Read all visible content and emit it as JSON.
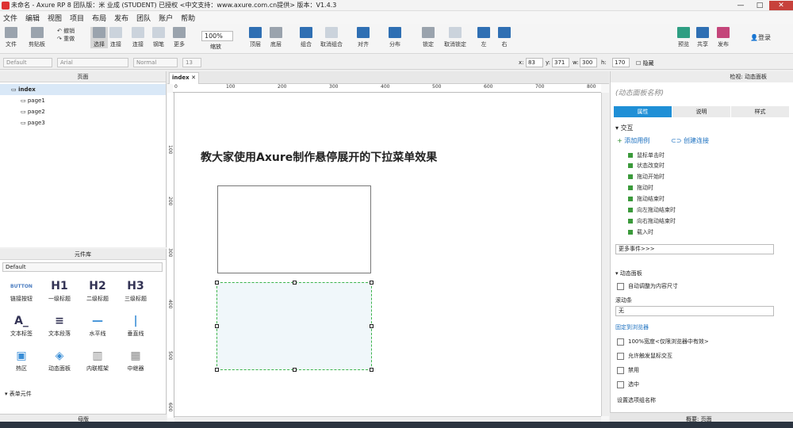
{
  "window": {
    "title": "未命名 - Axure RP 8 团队版：米 业成 (STUDENT) 已授权    <中文支持：www.axure.com.cn提供> 版本：V1.4.3",
    "minimize": "—",
    "maximize": "□",
    "close": "✕"
  },
  "menu": [
    "文件",
    "编辑",
    "视图",
    "项目",
    "布局",
    "发布",
    "团队",
    "账户",
    "帮助"
  ],
  "toolbar": {
    "file": "文件",
    "clipboard": "剪贴板",
    "cut_label": "",
    "undo": "撤销",
    "redo": "重做",
    "select": "选择",
    "connect": "连接",
    "pen": "钢笔",
    "more": "更多",
    "zoom_value": "100%",
    "zoom_label": "缩放",
    "top": "顶层",
    "bottom": "底层",
    "group": "组合",
    "ungroup": "取消组合",
    "align": "对齐",
    "distribute": "分布",
    "lock": "锁定",
    "unlock": "取消锁定",
    "left": "左",
    "right": "右",
    "preview": "预览",
    "share": "共享",
    "publish": "发布",
    "login": "登录"
  },
  "format": {
    "style": "Default",
    "font": "Arial",
    "weight": "Normal",
    "size": "13",
    "x_label": "x:",
    "x": "83",
    "y_label": "y:",
    "y": "371",
    "w_label": "w:",
    "w": "300",
    "h_label": "h:",
    "h": "170",
    "hide": "隐藏"
  },
  "pages_panel": {
    "title": "页面",
    "items": [
      "index",
      "page1",
      "page2",
      "page3"
    ]
  },
  "library": {
    "title": "元件库",
    "selected": "Default",
    "items": [
      {
        "icon": "BUTTON",
        "label": "链接按钮"
      },
      {
        "icon": "H1",
        "label": "一级标题"
      },
      {
        "icon": "H2",
        "label": "二级标题"
      },
      {
        "icon": "H3",
        "label": "三级标题"
      },
      {
        "icon": "A_",
        "label": "文本标签"
      },
      {
        "icon": "≡",
        "label": "文本段落"
      },
      {
        "icon": "—",
        "label": "水平线"
      },
      {
        "icon": "|",
        "label": "垂直线"
      },
      {
        "icon": "▣",
        "label": "热区"
      },
      {
        "icon": "◈",
        "label": "动态面板"
      },
      {
        "icon": "▥",
        "label": "内联框架"
      },
      {
        "icon": "▦",
        "label": "中继器"
      }
    ],
    "form_section": "表单元件"
  },
  "master": {
    "title": "母版"
  },
  "canvas": {
    "tab": "index",
    "ruler_h": [
      "0",
      "100",
      "200",
      "300",
      "400",
      "500",
      "600",
      "700",
      "800"
    ],
    "ruler_v": [
      "100",
      "200",
      "300",
      "400",
      "500",
      "600"
    ],
    "heading": "教大家使用Axure制作悬停展开的下拉菜单效果"
  },
  "inspector": {
    "header": "检视: 动态面板",
    "name_placeholder": "(动态面板名称)",
    "tabs": [
      "属性",
      "说明",
      "样式"
    ],
    "interaction_title": "交互",
    "add_case": "添加用例",
    "create_link": "创建连接",
    "events": [
      "鼠标单击时",
      "状态改变时",
      "拖动开始时",
      "拖动时",
      "拖动结束时",
      "向左拖动结束时",
      "向右拖动结束时",
      "载入时"
    ],
    "more_events": "更多事件>>>",
    "panel_section": "动态面板",
    "auto_fit": "自动调整为内容尺寸",
    "scrollbar_label": "滚动条",
    "scrollbar_value": "无",
    "pin": "固定到浏览器",
    "full_width": "100%宽度<仅限浏览器中有效>",
    "allow_trigger": "允许触发鼠标交互",
    "bottom_a": "禁用",
    "bottom_b": "选中",
    "bottom_c": "设置选项组名称",
    "status_left": "概要: 页面"
  }
}
